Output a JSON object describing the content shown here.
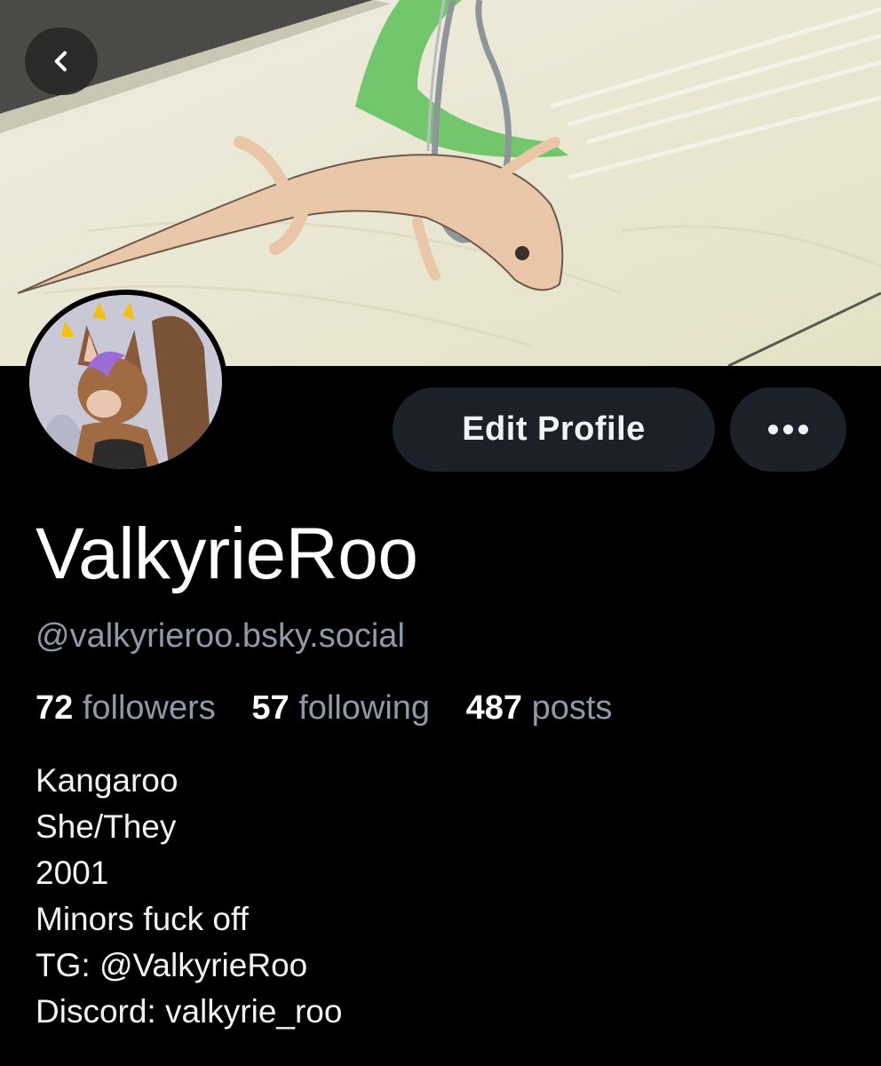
{
  "header": {
    "back_icon": "chevron-left-icon"
  },
  "profile": {
    "display_name": "ValkyrieRoo",
    "handle": "@valkyrieroo.bsky.social",
    "edit_button_label": "Edit Profile",
    "more_icon": "ellipsis-horizontal-icon",
    "stats": {
      "followers_count": "72",
      "followers_label": "followers",
      "following_count": "57",
      "following_label": "following",
      "posts_count": "487",
      "posts_label": "posts"
    },
    "bio_lines": [
      "Kangaroo",
      "She/They",
      "2001",
      "Minors fuck off",
      "TG: @ValkyrieRoo",
      "Discord: valkyrie_roo"
    ]
  },
  "colors": {
    "background": "#000000",
    "button_bg": "#1c2028",
    "muted_text": "#8d9aa8",
    "primary_text": "#ffffff"
  }
}
